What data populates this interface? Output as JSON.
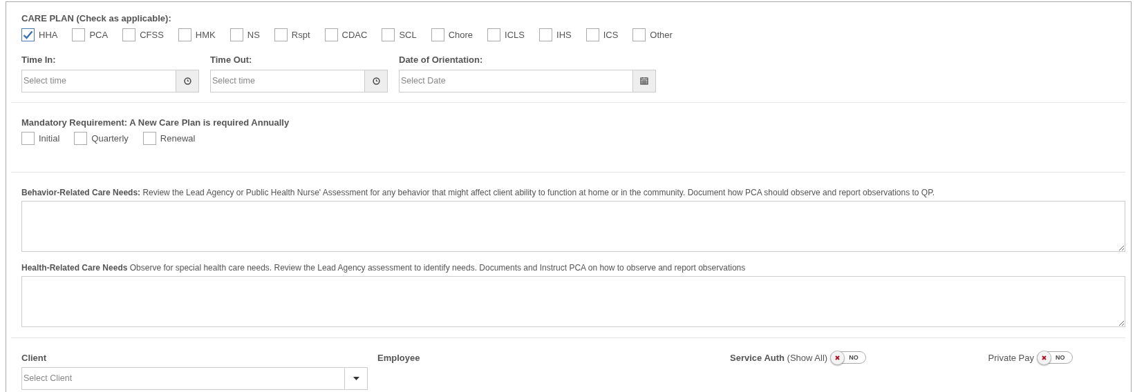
{
  "care_plan": {
    "title": "CARE PLAN (Check as applicable):",
    "options": [
      {
        "label": "HHA",
        "checked": true
      },
      {
        "label": "PCA",
        "checked": false
      },
      {
        "label": "CFSS",
        "checked": false
      },
      {
        "label": "HMK",
        "checked": false
      },
      {
        "label": "NS",
        "checked": false
      },
      {
        "label": "Rspt",
        "checked": false
      },
      {
        "label": "CDAC",
        "checked": false
      },
      {
        "label": "SCL",
        "checked": false
      },
      {
        "label": "Chore",
        "checked": false
      },
      {
        "label": "ICLS",
        "checked": false
      },
      {
        "label": "IHS",
        "checked": false
      },
      {
        "label": "ICS",
        "checked": false
      },
      {
        "label": "Other",
        "checked": false
      }
    ]
  },
  "time_fields": [
    {
      "label": "Time In:",
      "placeholder": "Select time",
      "kind": "time"
    },
    {
      "label": "Time Out:",
      "placeholder": "Select time",
      "kind": "time"
    },
    {
      "label": "Date of Orientation:",
      "placeholder": "Select Date",
      "kind": "date"
    }
  ],
  "mandatory": {
    "title": "Mandatory Requirement: A New Care Plan is required Annually",
    "options": [
      {
        "label": "Initial",
        "checked": false
      },
      {
        "label": "Quarterly",
        "checked": false
      },
      {
        "label": "Renewal",
        "checked": false
      }
    ]
  },
  "notes": [
    {
      "label": "**Behavior-Related Care Needs:** Review the Lead Agency or Public Health Nurse' Assessment for any behavior that might affect client ability to function at home or in the community. Document how PCA should observe and report observations to QP."
    },
    {
      "label": "**Health-Related Care Needs** Observe for special health care needs. Review the Lead Agency assessment to identify needs. Documents and Instruct PCA on how to observe and report observations"
    }
  ],
  "client": {
    "label": "Client",
    "placeholder": "Select Client"
  },
  "employee": {
    "label": "Employee"
  },
  "toggles": [
    {
      "label": "**Service Auth** (Show All)",
      "on": false,
      "state_text": "NO"
    },
    {
      "label": "Private Pay",
      "on": false,
      "state_text": "NO"
    }
  ]
}
